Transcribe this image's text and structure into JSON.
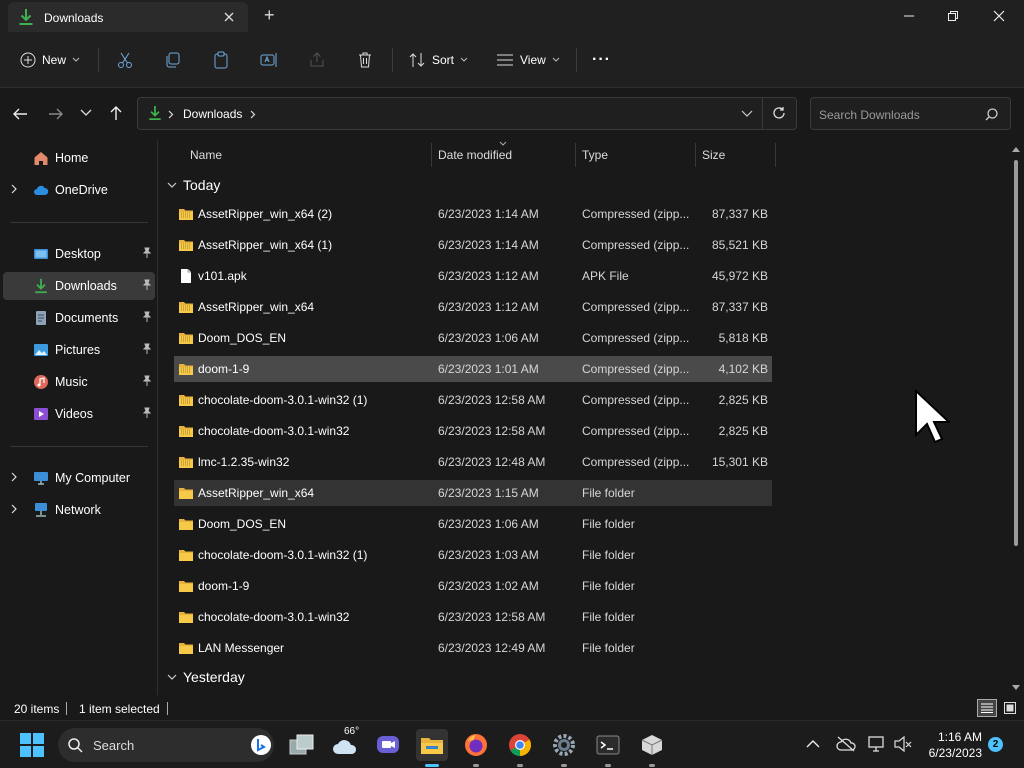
{
  "window": {
    "tab_title": "Downloads",
    "new_tab": "+",
    "controls": {
      "minimize": "minimize-icon",
      "maximize": "maximize-icon",
      "close": "close-icon"
    }
  },
  "toolbar": {
    "new_label": "New",
    "sort_label": "Sort",
    "view_label": "View",
    "more_label": "···"
  },
  "address": {
    "crumb": "Downloads",
    "search_placeholder": "Search Downloads"
  },
  "nav": {
    "items": [
      {
        "label": "Home",
        "icon": "home-icon"
      },
      {
        "label": "OneDrive",
        "icon": "cloud-icon"
      },
      {
        "label": "Desktop",
        "icon": "desktop-icon"
      },
      {
        "label": "Downloads",
        "icon": "download-icon"
      },
      {
        "label": "Documents",
        "icon": "document-icon"
      },
      {
        "label": "Pictures",
        "icon": "pictures-icon"
      },
      {
        "label": "Music",
        "icon": "music-icon"
      },
      {
        "label": "Videos",
        "icon": "video-icon"
      },
      {
        "label": "My Computer",
        "icon": "computer-icon"
      },
      {
        "label": "Network",
        "icon": "network-icon"
      }
    ]
  },
  "columns": {
    "name": "Name",
    "date": "Date modified",
    "type": "Type",
    "size": "Size"
  },
  "groups": {
    "today": "Today",
    "yesterday": "Yesterday"
  },
  "files": [
    {
      "name": "AssetRipper_win_x64 (2)",
      "date": "6/23/2023 1:14 AM",
      "type": "Compressed (zipp...",
      "size": "87,337 KB",
      "kind": "zip"
    },
    {
      "name": "AssetRipper_win_x64 (1)",
      "date": "6/23/2023 1:14 AM",
      "type": "Compressed (zipp...",
      "size": "85,521 KB",
      "kind": "zip"
    },
    {
      "name": "v101.apk",
      "date": "6/23/2023 1:12 AM",
      "type": "APK File",
      "size": "45,972 KB",
      "kind": "file"
    },
    {
      "name": "AssetRipper_win_x64",
      "date": "6/23/2023 1:12 AM",
      "type": "Compressed (zipp...",
      "size": "87,337 KB",
      "kind": "zip"
    },
    {
      "name": "Doom_DOS_EN",
      "date": "6/23/2023 1:06 AM",
      "type": "Compressed (zipp...",
      "size": "5,818 KB",
      "kind": "zip"
    },
    {
      "name": "doom-1-9",
      "date": "6/23/2023 1:01 AM",
      "type": "Compressed (zipp...",
      "size": "4,102 KB",
      "kind": "zip"
    },
    {
      "name": "chocolate-doom-3.0.1-win32 (1)",
      "date": "6/23/2023 12:58 AM",
      "type": "Compressed (zipp...",
      "size": "2,825 KB",
      "kind": "zip"
    },
    {
      "name": "chocolate-doom-3.0.1-win32",
      "date": "6/23/2023 12:58 AM",
      "type": "Compressed (zipp...",
      "size": "2,825 KB",
      "kind": "zip"
    },
    {
      "name": "lmc-1.2.35-win32",
      "date": "6/23/2023 12:48 AM",
      "type": "Compressed (zipp...",
      "size": "15,301 KB",
      "kind": "zip"
    },
    {
      "name": "AssetRipper_win_x64",
      "date": "6/23/2023 1:15 AM",
      "type": "File folder",
      "size": "",
      "kind": "folder"
    },
    {
      "name": "Doom_DOS_EN",
      "date": "6/23/2023 1:06 AM",
      "type": "File folder",
      "size": "",
      "kind": "folder"
    },
    {
      "name": "chocolate-doom-3.0.1-win32 (1)",
      "date": "6/23/2023 1:03 AM",
      "type": "File folder",
      "size": "",
      "kind": "folder"
    },
    {
      "name": "doom-1-9",
      "date": "6/23/2023 1:02 AM",
      "type": "File folder",
      "size": "",
      "kind": "folder"
    },
    {
      "name": "chocolate-doom-3.0.1-win32",
      "date": "6/23/2023 12:58 AM",
      "type": "File folder",
      "size": "",
      "kind": "folder"
    },
    {
      "name": "LAN Messenger",
      "date": "6/23/2023 12:49 AM",
      "type": "File folder",
      "size": "",
      "kind": "folder"
    }
  ],
  "selected_index": 5,
  "hover_index": 9,
  "status": {
    "items": "20 items",
    "selected": "1 item selected"
  },
  "taskbar": {
    "search_label": "Search",
    "weather_temp": "66°",
    "time": "1:16 AM",
    "date": "6/23/2023",
    "notifications": "2"
  },
  "colors": {
    "accent": "#3fb24f",
    "folder": "#f7c948",
    "selection": "#4a4a4a"
  }
}
